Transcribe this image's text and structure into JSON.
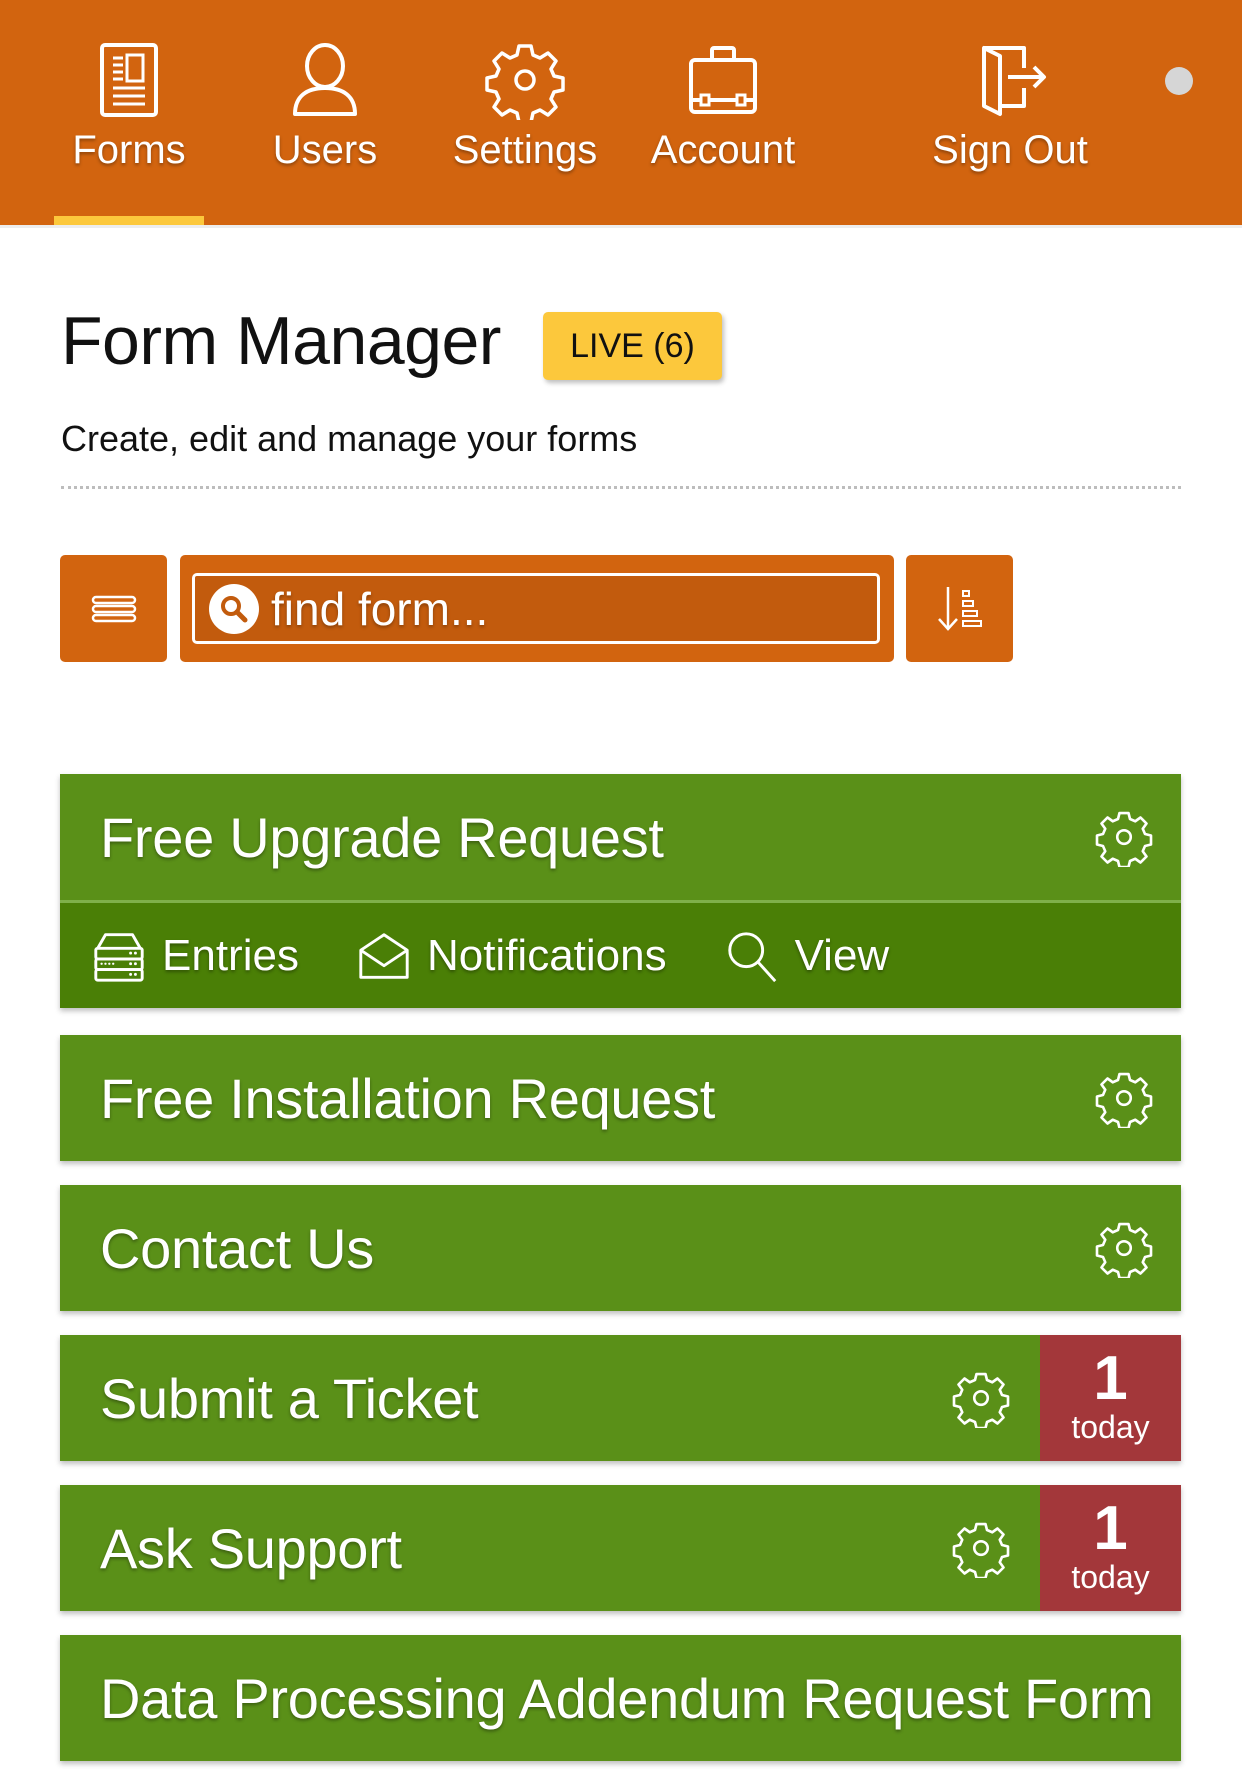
{
  "nav": {
    "items": [
      {
        "label": "Forms",
        "icon": "forms-document-icon",
        "active": true
      },
      {
        "label": "Users",
        "icon": "user-icon",
        "active": false
      },
      {
        "label": "Settings",
        "icon": "gear-icon",
        "active": false
      },
      {
        "label": "Account",
        "icon": "briefcase-icon",
        "active": false
      },
      {
        "label": "Sign Out",
        "icon": "sign-out-door-icon",
        "active": false
      }
    ],
    "status_dot_color": "#D6D6D6"
  },
  "page": {
    "title": "Form Manager",
    "live_badge": "LIVE (6)",
    "subtitle": "Create, edit and manage your forms"
  },
  "toolbar": {
    "menu_icon": "list-menu-icon",
    "search": {
      "placeholder": "find form...",
      "value": "",
      "icon": "search-icon"
    },
    "sort_icon": "sort-descending-icon"
  },
  "forms": [
    {
      "title": "Free Upgrade Request",
      "expanded": true,
      "actions": [
        {
          "label": "Entries",
          "icon": "entries-server-icon"
        },
        {
          "label": "Notifications",
          "icon": "envelope-open-icon"
        },
        {
          "label": "View",
          "icon": "search-icon"
        }
      ]
    },
    {
      "title": "Free Installation Request"
    },
    {
      "title": "Contact Us"
    },
    {
      "title": "Submit a Ticket",
      "today": {
        "count": "1",
        "label": "today"
      }
    },
    {
      "title": "Ask Support",
      "today": {
        "count": "1",
        "label": "today"
      }
    },
    {
      "title": "Data Processing Addendum Request Form"
    }
  ],
  "colors": {
    "header": "#D2640F",
    "active_indicator": "#FCC83C",
    "card_green": "#5A9018",
    "card_green_dark": "#4A7F06",
    "today_badge": "#A3373A",
    "live_badge": "#FCC83C"
  }
}
